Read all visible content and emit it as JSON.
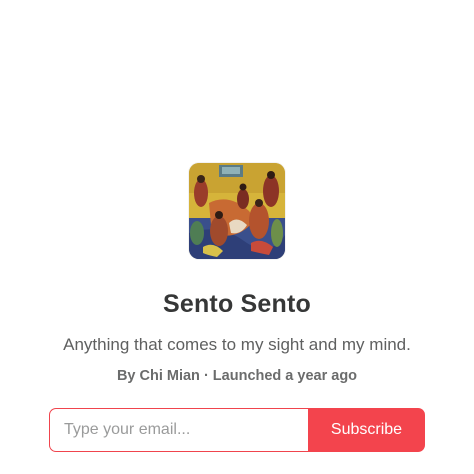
{
  "publication": {
    "name": "Sento Sento",
    "tagline": "Anything that comes to my sight and my mind.",
    "byline": "By Chi Mian · Launched a year ago"
  },
  "subscribe_form": {
    "email_placeholder": "Type your email...",
    "email_value": "",
    "button_label": "Subscribe"
  },
  "colors": {
    "accent": "#f3444d",
    "title": "#363737",
    "body_text": "#5f6060"
  }
}
